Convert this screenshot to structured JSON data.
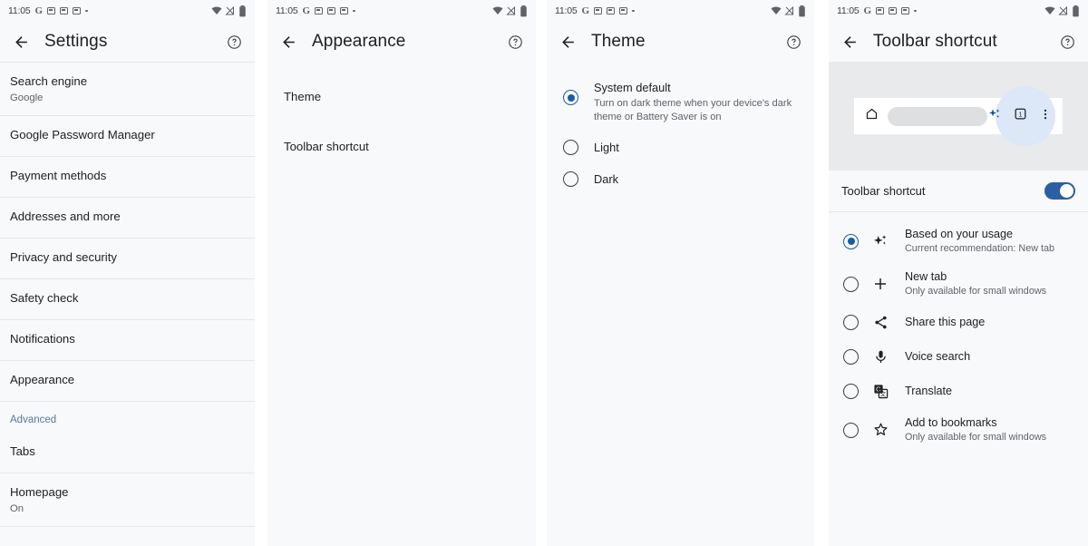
{
  "status_bar": {
    "time": "11:05",
    "google_glyph": "G",
    "app_icons": [
      "app-window-icon",
      "app-window-icon",
      "app-window-icon"
    ],
    "overflow_dot": "•",
    "right_icons": [
      "wifi-icon",
      "signal-off-icon",
      "battery-icon"
    ]
  },
  "panels": {
    "settings": {
      "title": "Settings",
      "back": "back-arrow",
      "help": "help-icon",
      "items": [
        {
          "primary": "Search engine",
          "secondary": "Google",
          "type": "row"
        },
        {
          "primary": "Google Password Manager",
          "secondary": "",
          "type": "row"
        },
        {
          "primary": "Payment methods",
          "secondary": "",
          "type": "row"
        },
        {
          "primary": "Addresses and more",
          "secondary": "",
          "type": "row"
        },
        {
          "primary": "Privacy and security",
          "secondary": "",
          "type": "row"
        },
        {
          "primary": "Safety check",
          "secondary": "",
          "type": "row"
        },
        {
          "primary": "Notifications",
          "secondary": "",
          "type": "row"
        },
        {
          "primary": "Appearance",
          "secondary": "",
          "type": "row"
        },
        {
          "primary": "Advanced",
          "secondary": "",
          "type": "section"
        },
        {
          "primary": "Tabs",
          "secondary": "",
          "type": "row"
        },
        {
          "primary": "Homepage",
          "secondary": "On",
          "type": "row"
        }
      ]
    },
    "appearance": {
      "title": "Appearance",
      "items": [
        {
          "label": "Theme"
        },
        {
          "label": "Toolbar shortcut"
        }
      ]
    },
    "theme": {
      "title": "Theme",
      "options": [
        {
          "label": "System default",
          "sub": "Turn on dark theme when your device's dark theme or Battery Saver is on",
          "selected": true
        },
        {
          "label": "Light",
          "sub": "",
          "selected": false
        },
        {
          "label": "Dark",
          "sub": "",
          "selected": false
        }
      ]
    },
    "toolbar_shortcut": {
      "title": "Toolbar shortcut",
      "preview": {
        "home_icon": "home-icon",
        "address_pill": "address-bar-placeholder",
        "sparkle_icon": "sparkle-icon",
        "tab_switcher_icon": "tab-count-icon",
        "tab_count": "1",
        "overflow_icon": "more-vertical-icon"
      },
      "toggle": {
        "label": "Toolbar shortcut",
        "on": true
      },
      "options": [
        {
          "label": "Based on your usage",
          "sub": "Current recommendation:  New tab",
          "icon": "sparkle-icon",
          "selected": true
        },
        {
          "label": "New tab",
          "sub": "Only available for small windows",
          "icon": "plus-icon",
          "selected": false
        },
        {
          "label": "Share this page",
          "sub": "",
          "icon": "share-icon",
          "selected": false
        },
        {
          "label": "Voice search",
          "sub": "",
          "icon": "microphone-icon",
          "selected": false
        },
        {
          "label": "Translate",
          "sub": "",
          "icon": "translate-icon",
          "selected": false
        },
        {
          "label": "Add to bookmarks",
          "sub": "Only available for small windows",
          "icon": "star-outline-icon",
          "selected": false
        }
      ]
    }
  },
  "colors": {
    "accent": "#1a5ba8",
    "toggle_on": "#2b5ea3",
    "section_header": "#5a7799",
    "panel_bg": "#f8f9fb",
    "preview_bg": "#e9eaec",
    "highlight": "#dce7f7"
  }
}
